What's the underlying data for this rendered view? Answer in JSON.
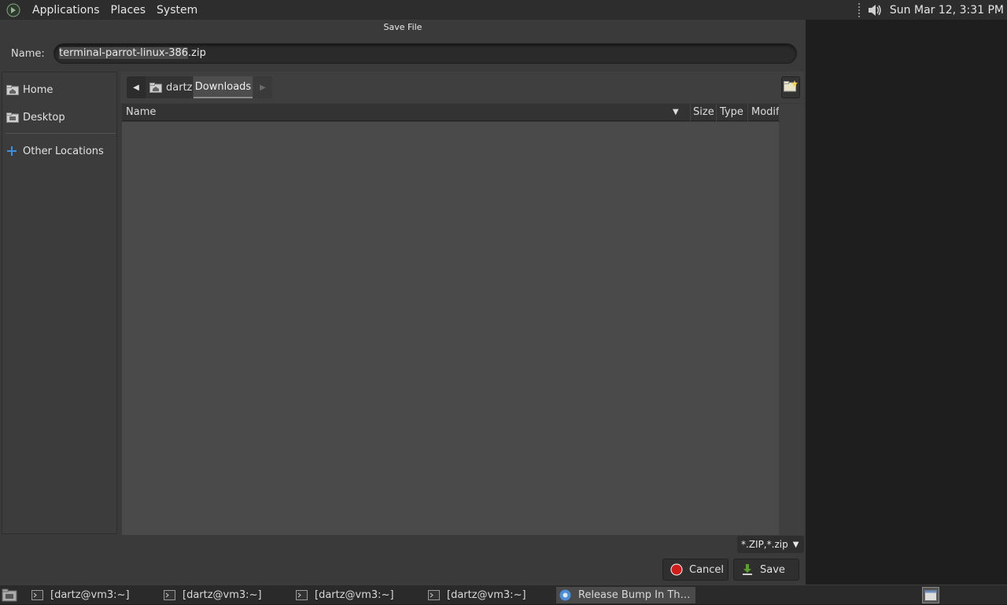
{
  "top_panel": {
    "menus": [
      "Applications",
      "Places",
      "System"
    ],
    "clock": "Sun Mar 12,  3:31 PM"
  },
  "dialog": {
    "title": "Save File",
    "name_label": "Name:",
    "filename_base": "terminal-parrot-linux-386",
    "filename_ext": ".zip",
    "sidebar": {
      "home": "Home",
      "desktop": "Desktop",
      "other_locations": "Other Locations"
    },
    "path": {
      "parent": "dartz",
      "current": "Downloads"
    },
    "columns": {
      "name": "Name",
      "size": "Size",
      "type": "Type",
      "modified": "Modif"
    },
    "filter": "*.ZIP,*.zip",
    "cancel_label": "Cancel",
    "save_label": "Save"
  },
  "taskbar": {
    "tasks": [
      "[dartz@vm3:~]",
      "[dartz@vm3:~]",
      "[dartz@vm3:~]",
      "[dartz@vm3:~]"
    ],
    "active_task": "Release Bump In Th…"
  },
  "colors": {
    "cancel_icon": "#d21b1b",
    "save_icon": "#5aa02c",
    "other_locations_icon": "#3d8fe0",
    "browser_icon": "#4a8fd8"
  }
}
